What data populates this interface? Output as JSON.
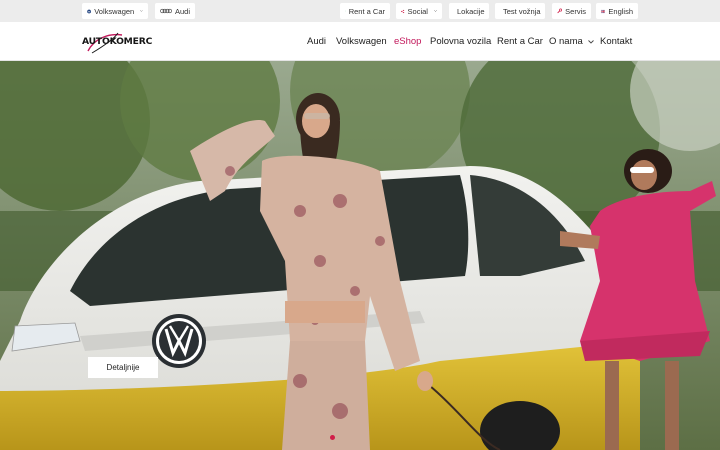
{
  "topbar": {
    "brands": [
      {
        "label": "Volkswagen",
        "icon": "vw-logo-icon"
      },
      {
        "label": "Audi",
        "icon": "audi-rings-icon"
      }
    ],
    "links": [
      {
        "label": "Rent a Car",
        "icon": "car-icon"
      },
      {
        "label": "Social",
        "icon": "share-icon"
      },
      {
        "label": "Lokacije",
        "icon": "location-pin-icon"
      },
      {
        "label": "Test vožnja",
        "icon": "steering-wheel-icon"
      },
      {
        "label": "Servis",
        "icon": "wrench-icon"
      },
      {
        "label": "English",
        "icon": "uk-flag-icon"
      }
    ]
  },
  "header": {
    "logo": "AUTOKOMERC",
    "nav": [
      {
        "label": "Audi"
      },
      {
        "label": "Volkswagen"
      },
      {
        "label": "eShop",
        "active": true
      },
      {
        "label": "Polovna vozila"
      },
      {
        "label": "Rent a Car"
      },
      {
        "label": "O nama",
        "dropdown": true
      },
      {
        "label": "Kontakt"
      }
    ]
  },
  "hero": {
    "button": "Detaljnije",
    "slides_total": 2,
    "active_slide": 1
  },
  "colors": {
    "accent": "#c2185b",
    "topbar_bg": "#ececec",
    "car_yellow": "#d9b928"
  }
}
